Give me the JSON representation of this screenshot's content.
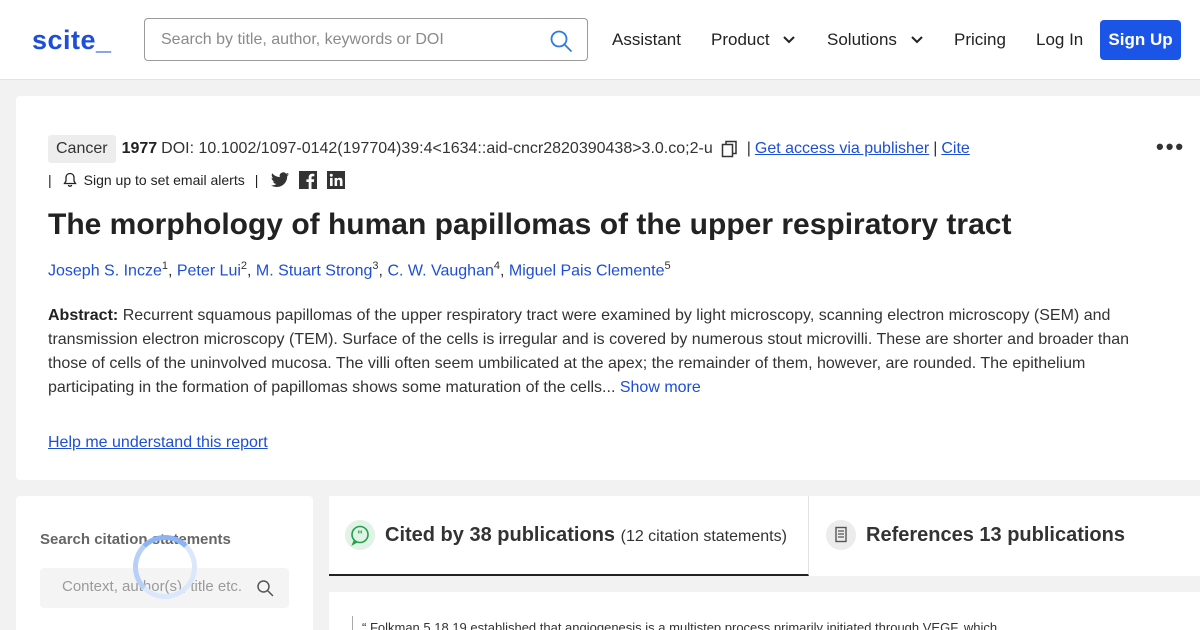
{
  "header": {
    "logo": "scite_",
    "search_placeholder": "Search by title, author, keywords or DOI",
    "nav": {
      "assistant": "Assistant",
      "product": "Product",
      "solutions": "Solutions",
      "pricing": "Pricing",
      "login": "Log In",
      "signup": "Sign Up"
    }
  },
  "article": {
    "tag": "Cancer",
    "year": "1977",
    "doi": "DOI: 10.1002/1097-0142(197704)39:4<1634::aid-cncr2820390438>3.0.co;2-u",
    "access_link": "Get access via publisher",
    "cite_link": "Cite",
    "alerts": "Sign up to set email alerts",
    "more": "•••",
    "title": "The morphology of human papillomas of the upper respiratory tract",
    "authors": [
      {
        "name": "Joseph S. Incze",
        "sup": "1"
      },
      {
        "name": "Peter Lui",
        "sup": "2"
      },
      {
        "name": "M. Stuart Strong",
        "sup": "3"
      },
      {
        "name": "C. W. Vaughan",
        "sup": "4"
      },
      {
        "name": "Miguel Pais Clemente",
        "sup": "5"
      }
    ],
    "abstract_label": "Abstract:",
    "abstract_text": "Recurrent squamous papillomas of the upper respiratory tract were examined by light microscopy, scanning electron microscopy (SEM) and transmission electron microscopy (TEM). Surface of the cells is irregular and is covered by numerous stout microvilli. These are shorter and broader than those of cells of the uninvolved mucosa. The villi often seem umbilicated at the apex; the remainder of them, however, are rounded. The epithelium participating in the formation of papillomas shows some maturation of the cells...",
    "show_more": "Show more",
    "help_link": "Help me understand this report"
  },
  "citations_panel": {
    "title": "Search citation statements",
    "placeholder": "Context, author(s), title etc."
  },
  "tabs": {
    "cited_by": "Cited by 38 publications",
    "cited_by_sub": "(12 citation statements)",
    "references": "References 13 publications"
  },
  "quote": {
    "text": "“  Folkman 5,18,19 established that angiogenesis is a multistep process primarily initiated through VEGF, which"
  },
  "colors": {
    "brand": "#1d4ed8",
    "signup_bg": "#1b55e8"
  }
}
